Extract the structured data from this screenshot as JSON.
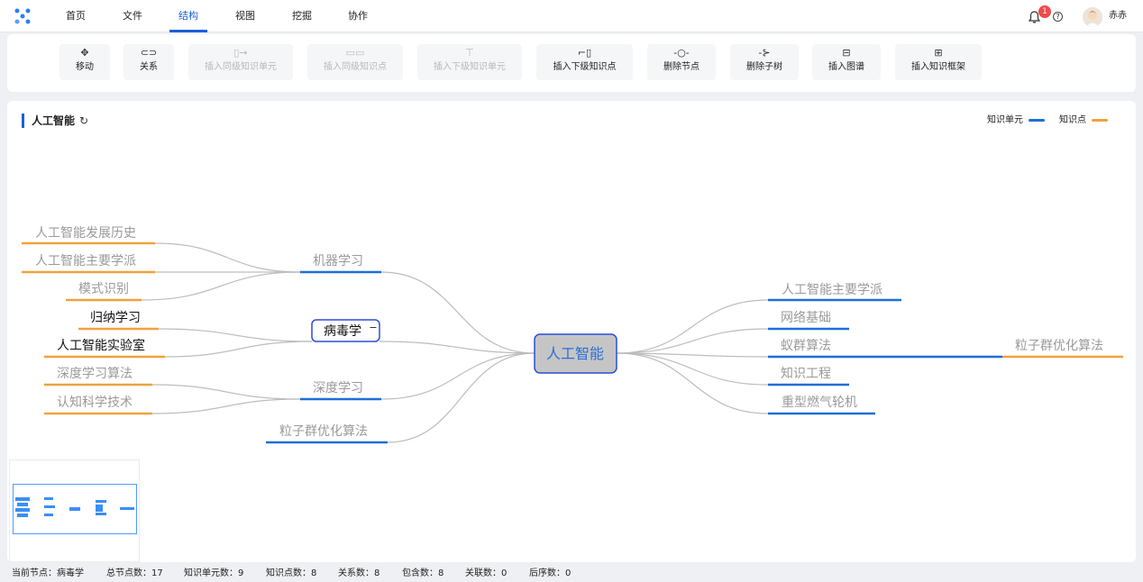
{
  "nav": {
    "items": [
      "首页",
      "文件",
      "结构",
      "视图",
      "挖掘",
      "协作"
    ],
    "active_index": 2,
    "notification_count": "1",
    "username": "赤赤"
  },
  "toolbar": {
    "items": [
      {
        "label": "移动",
        "icon": "move-icon",
        "enabled": true
      },
      {
        "label": "关系",
        "icon": "link-icon",
        "enabled": true
      },
      {
        "label": "插入同级知识单元",
        "icon": "insert-sibling-unit-icon",
        "enabled": false
      },
      {
        "label": "插入同级知识点",
        "icon": "insert-sibling-point-icon",
        "enabled": false
      },
      {
        "label": "插入下级知识单元",
        "icon": "insert-child-unit-icon",
        "enabled": false
      },
      {
        "label": "插入下级知识点",
        "icon": "insert-child-point-icon",
        "enabled": true
      },
      {
        "label": "删除节点",
        "icon": "delete-node-icon",
        "enabled": true
      },
      {
        "label": "删除子树",
        "icon": "delete-subtree-icon",
        "enabled": true
      },
      {
        "label": "插入图谱",
        "icon": "insert-graph-icon",
        "enabled": true
      },
      {
        "label": "插入知识框架",
        "icon": "insert-framework-icon",
        "enabled": true
      }
    ]
  },
  "panel": {
    "title": "人工智能",
    "legend": [
      {
        "label": "知识单元",
        "color": "#1d6fd8"
      },
      {
        "label": "知识点",
        "color": "#f0a23c"
      }
    ]
  },
  "mindmap": {
    "root": "人工智能",
    "left_branches": [
      {
        "label": "机器学习",
        "children": [
          "人工智能发展历史",
          "人工智能主要学派",
          "模式识别"
        ]
      },
      {
        "label": "病毒学",
        "selected": true,
        "collapse_symbol": "−",
        "children": [
          "归纳学习",
          "人工智能实验室"
        ]
      },
      {
        "label": "深度学习",
        "children": [
          "深度学习算法",
          "认知科学技术"
        ]
      },
      {
        "label": "粒子群优化算法",
        "children": []
      }
    ],
    "right_branches": [
      {
        "label": "人工智能主要学派",
        "children": []
      },
      {
        "label": "网络基础",
        "children": []
      },
      {
        "label": "蚁群算法",
        "children": [
          "粒子群优化算法"
        ]
      },
      {
        "label": "知识工程",
        "children": []
      },
      {
        "label": "重型燃气轮机",
        "children": []
      }
    ]
  },
  "status": {
    "current_node": "当前节点：病毒学",
    "total_nodes": "总节点数：17",
    "unit_count": "知识单元数：9",
    "point_count": "知识点数：8",
    "relation_count": "关系数：8",
    "contain_count": "包含数：8",
    "assoc_count": "关联数：0",
    "sequence_count": "后序数：0"
  }
}
